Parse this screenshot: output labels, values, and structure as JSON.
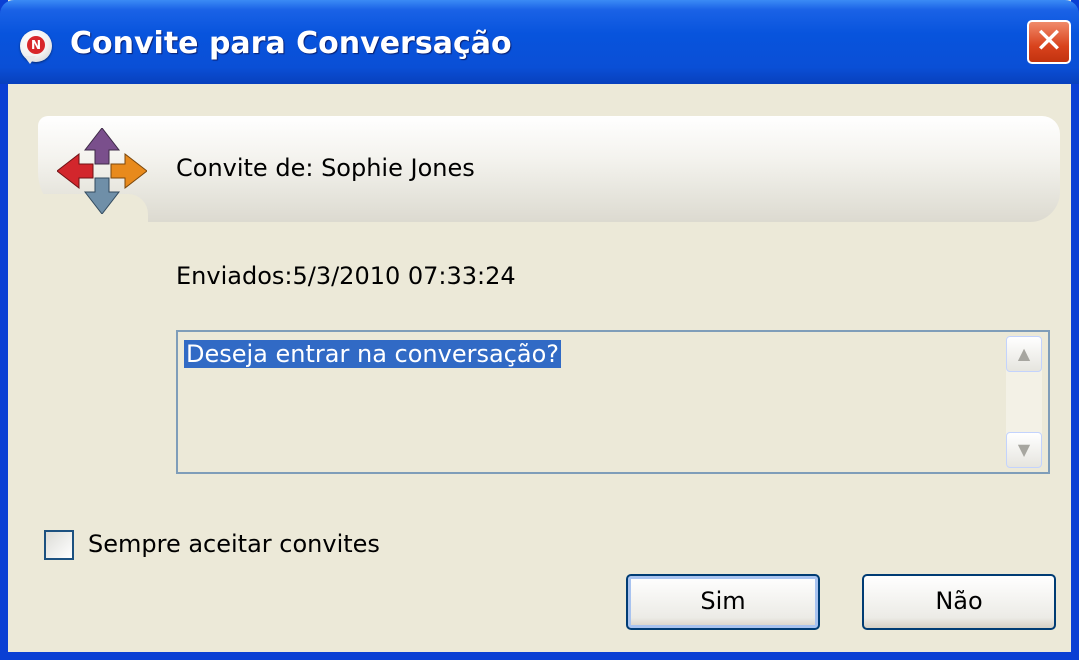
{
  "window": {
    "title": "Convite para Conversação",
    "close_label": "✕"
  },
  "invitation": {
    "from_label": "Convite de:",
    "from_name": "Sophie Jones",
    "sent_label": "Enviados:",
    "sent_datetime": "5/3/2010 07:33:24",
    "message": "Deseja entrar na conversação?"
  },
  "options": {
    "always_accept_label": "Sempre aceitar convites",
    "always_accept_checked": false
  },
  "buttons": {
    "yes_label": "Sim",
    "no_label": "Não"
  },
  "icons": {
    "title": "novell-messenger-icon",
    "invite": "invitation-arrows-icon",
    "scroll_up": "scroll-up-icon",
    "scroll_down": "scroll-down-icon"
  },
  "colors": {
    "titlebar": "#0a4fd6",
    "window_bg": "#ece9d8",
    "selection": "#316ac5",
    "close_button": "#d9431d"
  }
}
